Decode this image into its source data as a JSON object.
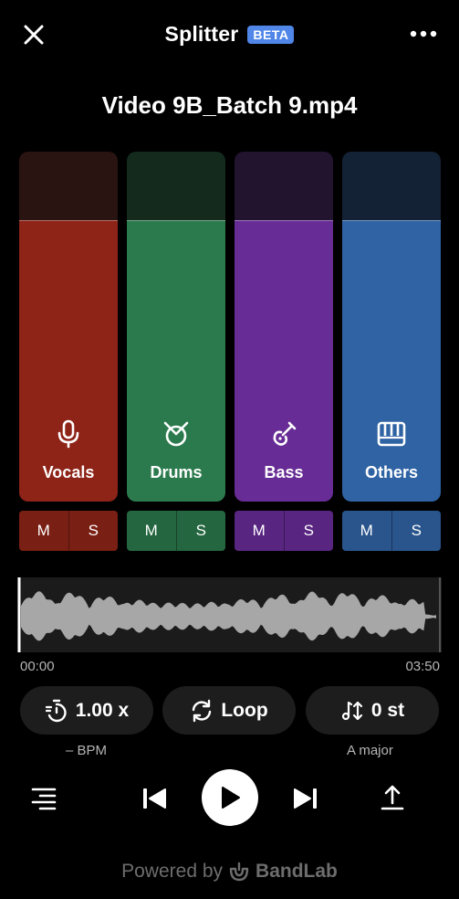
{
  "header": {
    "title": "Splitter",
    "badge": "BETA",
    "close_icon": "close-icon",
    "more_icon": "more-horizontal-icon"
  },
  "file": {
    "name": "Video 9B_Batch 9.mp4"
  },
  "tracks": [
    {
      "label": "Vocals",
      "icon": "microphone-icon",
      "mute": "M",
      "solo": "S",
      "color": "#8e2318",
      "top_color": "#2a1412",
      "ms_color": "#7a1f14",
      "level": 0.8
    },
    {
      "label": "Drums",
      "icon": "drum-icon",
      "mute": "M",
      "solo": "S",
      "color": "#2b7a4d",
      "top_color": "#132a1d",
      "ms_color": "#24663f",
      "level": 0.8
    },
    {
      "label": "Bass",
      "icon": "guitar-icon",
      "mute": "M",
      "solo": "S",
      "color": "#672c95",
      "top_color": "#22132f",
      "ms_color": "#582581",
      "level": 0.8
    },
    {
      "label": "Others",
      "icon": "piano-icon",
      "mute": "M",
      "solo": "S",
      "color": "#2f63a4",
      "top_color": "#142236",
      "ms_color": "#29558c",
      "level": 0.8
    }
  ],
  "timeline": {
    "start": "00:00",
    "end": "03:50",
    "position": 0.0
  },
  "controls": {
    "speed": {
      "value": "1.00 x",
      "sub": "– BPM",
      "icon": "speed-timer-icon"
    },
    "loop": {
      "label": "Loop",
      "icon": "loop-icon"
    },
    "pitch": {
      "value": "0 st",
      "sub": "A major",
      "icon": "pitch-shift-icon"
    }
  },
  "transport": {
    "lyrics_icon": "list-icon",
    "prev_icon": "skip-previous-icon",
    "play_icon": "play-icon",
    "next_icon": "skip-next-icon",
    "export_icon": "upload-icon"
  },
  "footer": {
    "powered_by": "Powered by",
    "brand": "BandLab",
    "brand_icon": "bandlab-logo-icon"
  }
}
